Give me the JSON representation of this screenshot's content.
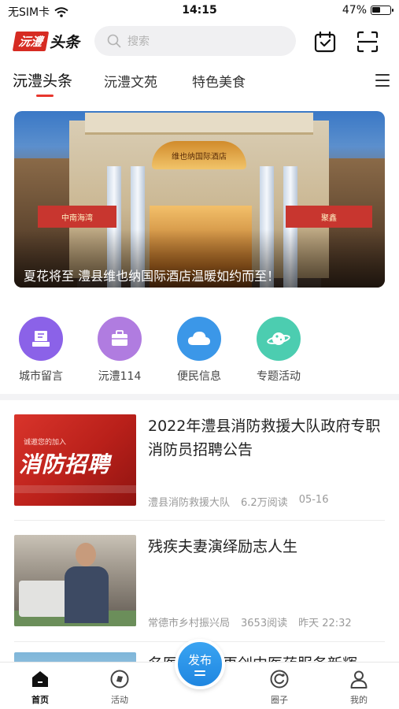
{
  "status_bar": {
    "carrier": "无SIM卡",
    "time": "14:15",
    "battery": "47%",
    "battery_level": 0.47
  },
  "header": {
    "logo_badge": "沅澧",
    "logo_text": "头条",
    "search_placeholder": "搜索",
    "icons": [
      "calendar-check-icon",
      "scan-icon"
    ]
  },
  "tabs": {
    "items": [
      {
        "label": "沅澧头条",
        "active": true
      },
      {
        "label": "沅澧文苑",
        "active": false
      },
      {
        "label": "特色美食",
        "active": false
      }
    ],
    "accent": "#e8362d"
  },
  "banner": {
    "caption": "夏花将至 澧县维也纳国际酒店温暖如约而至！",
    "sign": "维也纳国际酒店",
    "red_left": "中南海湾",
    "red_right": "聚鑫"
  },
  "quick_entries": [
    {
      "label": "城市留言",
      "icon": "message-board-icon",
      "color": "#8b62e8"
    },
    {
      "label": "沅澧114",
      "icon": "briefcase-icon",
      "color": "#b07ce0"
    },
    {
      "label": "便民信息",
      "icon": "cloud-icon",
      "color": "#3b97e8"
    },
    {
      "label": "专题活动",
      "icon": "planet-icon",
      "color": "#4ccdb0"
    }
  ],
  "news": [
    {
      "title": "2022年澧县消防救援大队政府专职消防员招聘公告",
      "source": "澧县消防救援大队",
      "reads": "6.2万阅读",
      "date": "05-16",
      "thumb_big": "消防招聘",
      "thumb_small": "诚邀您的加入"
    },
    {
      "title": "残疾夫妻演绎励志人生",
      "source": "常德市乡村振兴局",
      "reads": "3653阅读",
      "date": "昨天 22:32"
    },
    {
      "title": "名医荟萃，再创中医药服务新辉"
    }
  ],
  "bottom_nav": {
    "items": [
      {
        "label": "首页",
        "icon": "home-icon",
        "active": true
      },
      {
        "label": "活动",
        "icon": "activity-icon",
        "active": false
      },
      {
        "label": "圈子",
        "icon": "circle-icon",
        "active": false
      },
      {
        "label": "我的",
        "icon": "user-icon",
        "active": false
      }
    ],
    "publish_label": "发布",
    "publish_color": "#2a95e8"
  }
}
